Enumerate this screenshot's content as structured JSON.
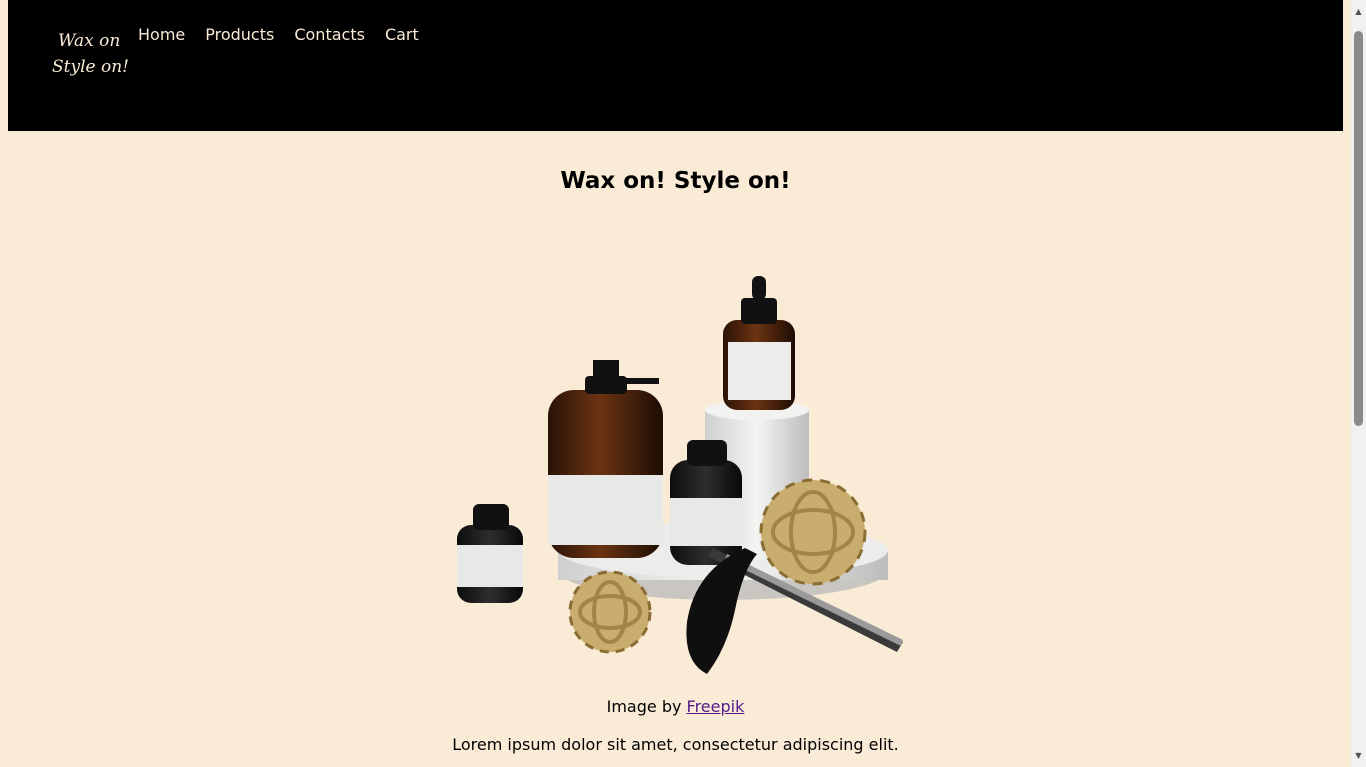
{
  "logo": {
    "line1": "Wax on",
    "line2": "Style on!"
  },
  "nav": {
    "items": [
      "Home",
      "Products",
      "Contacts",
      "Cart"
    ]
  },
  "main": {
    "title": "Wax on! Style on!",
    "image_alt": "Grooming product bottles with straight razor",
    "credit_prefix": "Image by ",
    "credit_link": "Freepik",
    "description": "Lorem ipsum dolor sit amet, consectetur adipiscing elit."
  },
  "colors": {
    "background": "#faebd7",
    "header": "#000000",
    "nav_text": "#faebd7",
    "link_visited": "#551a8b"
  },
  "icons": {
    "scroll_up": "triangle-up",
    "scroll_down": "triangle-down"
  }
}
